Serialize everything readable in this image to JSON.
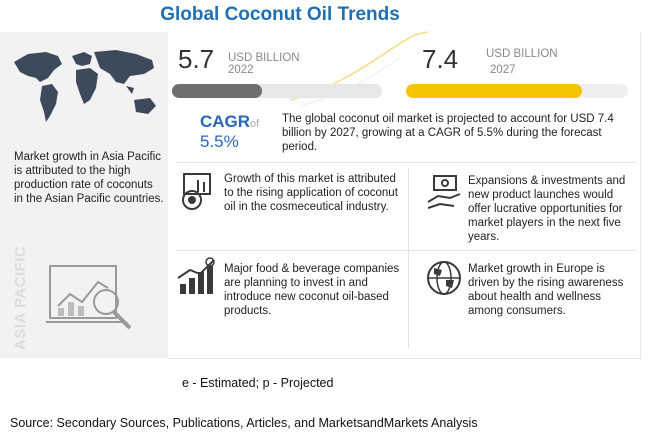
{
  "title": "Global Coconut Oil Trends",
  "left_panel": {
    "text": "Market growth in Asia Pacific is attributed to the high production rate of coconuts in the Asian Pacific countries.",
    "vertical_label": "ASIA PACIFIC",
    "icons": [
      "world-map-icon",
      "magnifier-chart-icon"
    ]
  },
  "market_values": {
    "start": {
      "value": "5.7",
      "unit": "USD BILLION",
      "year": "2022"
    },
    "end": {
      "value": "7.4",
      "unit": "USD BILLION",
      "year": "2027"
    },
    "start_bar_color": "#6e6e6e",
    "end_bar_color": "#f5c400"
  },
  "cagr": {
    "label": "CAGR",
    "of_text": "of",
    "value": "5.5%",
    "description": "The global coconut oil market is projected to account for USD 7.4 billion by 2027, growing at a CAGR of 5.5% during the forecast period."
  },
  "highlights": [
    {
      "icon": "coconut-oil-icon",
      "text": "Growth of this market is attributed to the rising application of coconut oil in the cosmeceutical industry."
    },
    {
      "icon": "money-hand-icon",
      "text": "Expansions & investments and new product launches would offer lucrative opportunities for market players in the next five years."
    },
    {
      "icon": "growth-chart-icon",
      "text": "Major food & beverage companies are planning to invest in and introduce new coconut oil-based products."
    },
    {
      "icon": "globe-icon",
      "text": "Market growth in Europe is driven by the rising awareness about health and wellness among consumers."
    }
  ],
  "footnote": "e - Estimated; p - Projected",
  "source": "Source: Secondary Sources, Publications, Articles, and MarketsandMarkets Analysis",
  "colors": {
    "title": "#1f6fb5",
    "cagr": "#2a66b8",
    "icon": "#3a3a3a"
  }
}
